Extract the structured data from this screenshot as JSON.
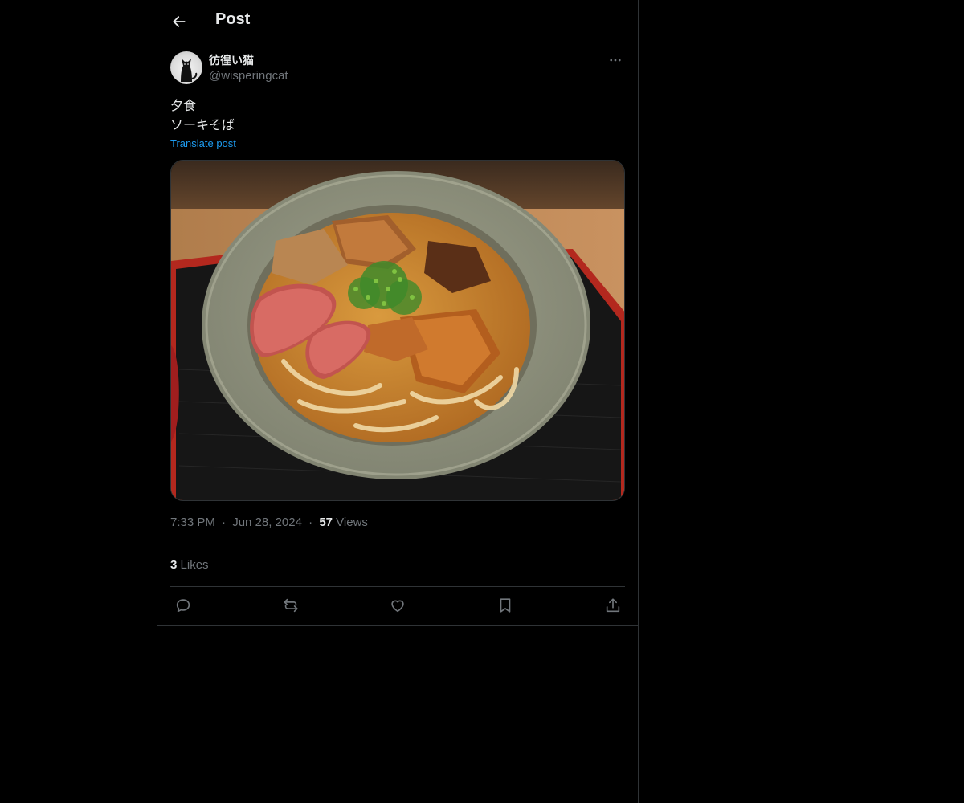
{
  "header": {
    "title": "Post"
  },
  "post": {
    "author": {
      "display_name": "彷徨い猫",
      "handle": "@wisperingcat"
    },
    "text_lines": [
      "夕食",
      "ソーキそば"
    ],
    "translate_label": "Translate post",
    "time": "7:33 PM",
    "date": "Jun 28, 2024",
    "separator": "·",
    "views_count": "57",
    "views_label": "Views",
    "likes_count": "3",
    "likes_label": "Likes"
  },
  "icons": {
    "back": "arrow-left-icon",
    "more": "more-horizontal-icon",
    "reply": "reply-icon",
    "repost": "repost-icon",
    "like": "heart-icon",
    "bookmark": "bookmark-icon",
    "share": "share-icon"
  },
  "colors": {
    "background": "#000000",
    "text": "#e7e9ea",
    "muted": "#71767b",
    "link": "#1d9bf0",
    "border": "#2f3336"
  }
}
